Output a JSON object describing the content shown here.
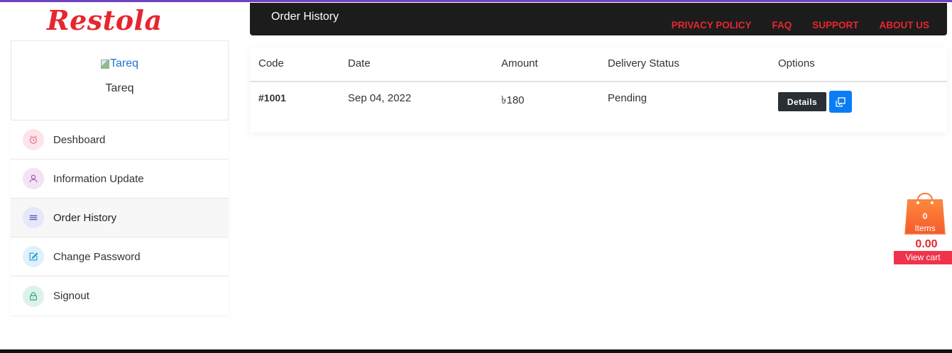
{
  "brand": {
    "logo_text": "Restola",
    "accent": "#e8262f"
  },
  "profile": {
    "avatar_alt": "Tareq",
    "name": "Tareq"
  },
  "sidebar": {
    "items": [
      {
        "label": "Deshboard",
        "icon": "alarm-clock-icon",
        "icon_bg": "#fde4ea",
        "icon_color": "#e36a82"
      },
      {
        "label": "Information Update",
        "icon": "user-icon",
        "icon_bg": "#f3e3f5",
        "icon_color": "#a257b0"
      },
      {
        "label": "Order History",
        "icon": "list-icon",
        "icon_bg": "#e6e7f8",
        "icon_color": "#4a55b0"
      },
      {
        "label": "Change Password",
        "icon": "edit-icon",
        "icon_bg": "#dff1fb",
        "icon_color": "#1b9ad6"
      },
      {
        "label": "Signout",
        "icon": "lock-icon",
        "icon_bg": "#ddf3ea",
        "icon_color": "#2aa67a"
      }
    ]
  },
  "header": {
    "title": "Order History",
    "nav": [
      "PRIVACY POLICY",
      "FAQ",
      "SUPPORT",
      "ABOUT US"
    ]
  },
  "orders": {
    "columns": [
      "Code",
      "Date",
      "Amount",
      "Delivery Status",
      "Options"
    ],
    "rows": [
      {
        "code": "#1001",
        "date": "Sep 04, 2022",
        "amount": "৳180",
        "status": "Pending",
        "details_label": "Details"
      }
    ]
  },
  "cart": {
    "count": "0",
    "items_label": "Items",
    "total": "0.00",
    "view_label": "View cart"
  }
}
